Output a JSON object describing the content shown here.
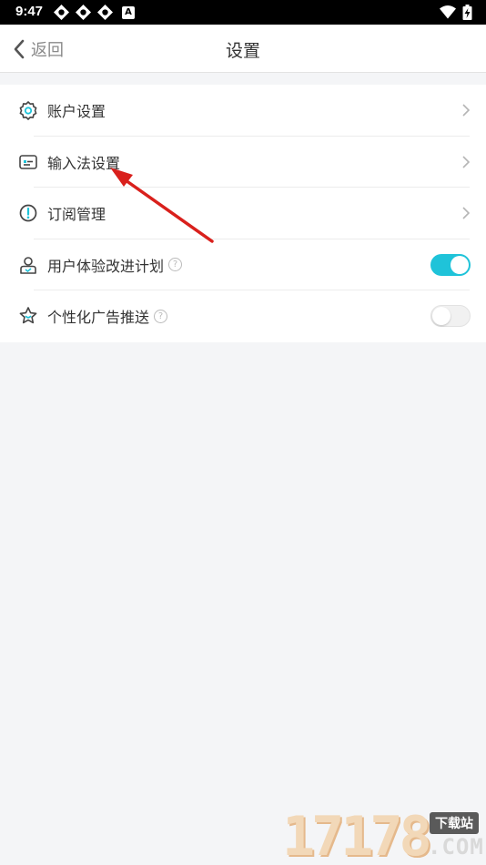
{
  "status_bar": {
    "time": "9:47",
    "notification_icons": [
      "app-icon",
      "app-icon",
      "app-icon",
      "a-icon"
    ],
    "a_icon_letter": "A",
    "right_icons": [
      "wifi-icon",
      "battery-charging-icon"
    ]
  },
  "header": {
    "back_label": "返回",
    "title": "设置"
  },
  "settings": {
    "items": [
      {
        "label": "账户设置",
        "icon": "gear-icon",
        "control": "chevron"
      },
      {
        "label": "输入法设置",
        "icon": "keyboard-icon",
        "control": "chevron"
      },
      {
        "label": "订阅管理",
        "icon": "alert-circle-icon",
        "control": "chevron"
      },
      {
        "label": "用户体验改进计划",
        "icon": "user-icon",
        "control": "toggle",
        "on": true,
        "help": "?"
      },
      {
        "label": "个性化广告推送",
        "icon": "star-icon",
        "control": "toggle",
        "on": false,
        "help": "?"
      }
    ]
  },
  "colors": {
    "accent": "#1fc3d9",
    "annotation_arrow": "#d9201c",
    "background": "#f4f5f7"
  },
  "watermark": {
    "digits": "17178",
    "badge": "下载站",
    "suffix": ".COM"
  }
}
